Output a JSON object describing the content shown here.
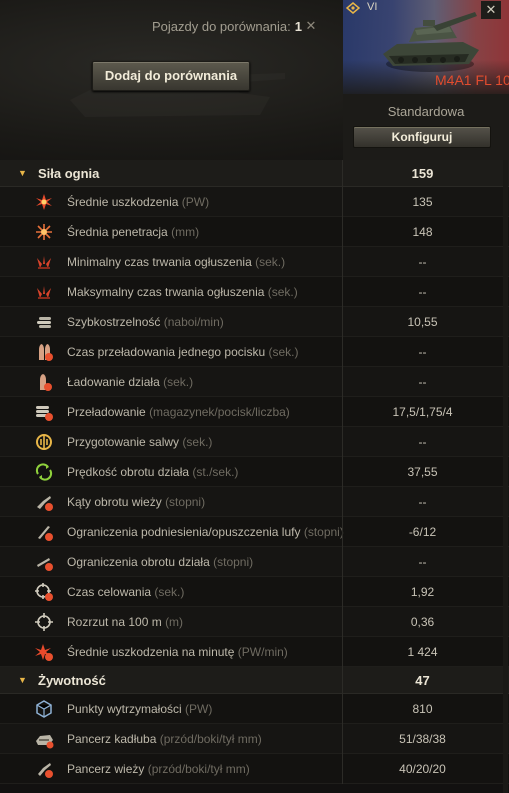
{
  "header": {
    "compare_label": "Pojazdy do porównania:",
    "compare_count": "1",
    "add_button": "Dodaj do porównania"
  },
  "vehicle": {
    "tier": "VI",
    "name": "M4A1 FL 10",
    "configuration": "Standardowa",
    "configure_button": "Konfiguruj",
    "name_color": "#e24c2e"
  },
  "sections": [
    {
      "title": "Siła ognia",
      "value": "159",
      "stats": [
        {
          "icon": "damage-icon",
          "label": "Średnie uszkodzenia",
          "unit": "(PW)",
          "value": "135"
        },
        {
          "icon": "penetration-icon",
          "label": "Średnia penetracja",
          "unit": "(mm)",
          "value": "148"
        },
        {
          "icon": "stun-min-icon",
          "label": "Minimalny czas trwania ogłuszenia",
          "unit": "(sek.)",
          "value": "--"
        },
        {
          "icon": "stun-max-icon",
          "label": "Maksymalny czas trwania ogłuszenia",
          "unit": "(sek.)",
          "value": "--"
        },
        {
          "icon": "rate-of-fire-icon",
          "label": "Szybkostrzelność",
          "unit": "(naboi/min)",
          "value": "10,55"
        },
        {
          "icon": "shell-reload-icon",
          "label": "Czas przeładowania jednego pocisku",
          "unit": "(sek.)",
          "value": "--"
        },
        {
          "icon": "gun-loading-icon",
          "label": "Ładowanie działa",
          "unit": "(sek.)",
          "value": "--"
        },
        {
          "icon": "magazine-reload-icon",
          "label": "Przeładowanie",
          "unit": "(magazynek/pocisk/liczba)",
          "value": "17,5/1,75/4"
        },
        {
          "icon": "salvo-icon",
          "label": "Przygotowanie salwy",
          "unit": "(sek.)",
          "value": "--"
        },
        {
          "icon": "gun-traverse-speed-icon",
          "label": "Prędkość obrotu działa",
          "unit": "(st./sek.)",
          "value": "37,55"
        },
        {
          "icon": "turret-angles-icon",
          "label": "Kąty obrotu wieży",
          "unit": "(stopni)",
          "value": "--"
        },
        {
          "icon": "elevation-icon",
          "label": "Ograniczenia podniesienia/opuszczenia lufy",
          "unit": "(stopni)",
          "value": "-6/12"
        },
        {
          "icon": "gun-traverse-limits-icon",
          "label": "Ograniczenia obrotu działa",
          "unit": "(stopni)",
          "value": "--"
        },
        {
          "icon": "aiming-time-icon",
          "label": "Czas celowania",
          "unit": "(sek.)",
          "value": "1,92"
        },
        {
          "icon": "dispersion-icon",
          "label": "Rozrzut na 100 m",
          "unit": "(m)",
          "value": "0,36"
        },
        {
          "icon": "damage-per-minute-icon",
          "label": "Średnie uszkodzenia na minutę",
          "unit": "(PW/min)",
          "value": "1 424"
        }
      ]
    },
    {
      "title": "Żywotność",
      "value": "47",
      "stats": [
        {
          "icon": "hit-points-icon",
          "label": "Punkty wytrzymałości",
          "unit": "(PW)",
          "value": "810"
        },
        {
          "icon": "hull-armor-icon",
          "label": "Pancerz kadłuba",
          "unit": "(przód/boki/tył mm)",
          "value": "51/38/38"
        },
        {
          "icon": "turret-armor-icon",
          "label": "Pancerz wieży",
          "unit": "(przód/boki/tył mm)",
          "value": "40/20/20"
        }
      ]
    }
  ]
}
